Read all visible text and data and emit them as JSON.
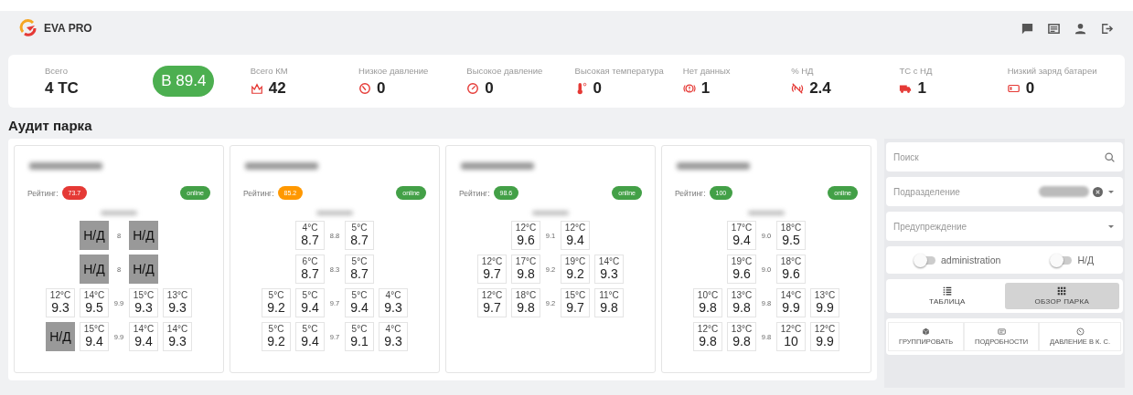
{
  "app": {
    "name": "EVA PRO"
  },
  "stats": [
    {
      "kind": "total",
      "label": "Всего",
      "value": "4 ТС"
    },
    {
      "kind": "rating",
      "value": "B 89.4"
    },
    {
      "kind": "distance",
      "label": "Всего КМ",
      "value": "42"
    },
    {
      "kind": "low_pressure",
      "label": "Низкое давление",
      "value": "0"
    },
    {
      "kind": "high_pressure",
      "label": "Высокое давление",
      "value": "0"
    },
    {
      "kind": "temperature",
      "label": "Высокая температура",
      "value": "0"
    },
    {
      "kind": "no_data",
      "label": "Нет данных",
      "value": "1"
    },
    {
      "kind": "no_signal",
      "label": "% НД",
      "value": "2.4"
    },
    {
      "kind": "vehicles_no_data",
      "label": "ТС с НД",
      "value": "1"
    },
    {
      "kind": "battery",
      "label": "Низкий заряд батареи",
      "value": "0"
    }
  ],
  "page_title": "Аудит парка",
  "vehicles": [
    {
      "rating_label": "Рейтинг:",
      "rating": "73.7",
      "color": "#e53935",
      "status": "online",
      "axles": [
        {
          "left": [
            {
              "kind": "nodata",
              "label": "Н/Д"
            }
          ],
          "center": "8",
          "right": [
            {
              "kind": "nodata",
              "label": "Н/Д"
            }
          ]
        },
        {
          "left": [
            {
              "kind": "nodata",
              "label": "Н/Д"
            }
          ],
          "center": "8",
          "right": [
            {
              "kind": "nodata",
              "label": "Н/Д"
            }
          ]
        },
        {
          "left": [
            {
              "kind": "reading",
              "temp": "12°C",
              "pressure": "9.3"
            },
            {
              "kind": "reading",
              "temp": "14°C",
              "pressure": "9.5"
            }
          ],
          "center": "9.9",
          "right": [
            {
              "kind": "reading",
              "temp": "15°C",
              "pressure": "9.3"
            },
            {
              "kind": "reading",
              "temp": "13°C",
              "pressure": "9.3"
            }
          ]
        },
        {
          "left": [
            {
              "kind": "nodata",
              "label": "Н/Д"
            },
            {
              "kind": "reading",
              "temp": "15°C",
              "pressure": "9.4"
            }
          ],
          "center": "9.9",
          "right": [
            {
              "kind": "reading",
              "temp": "14°C",
              "pressure": "9.4"
            },
            {
              "kind": "reading",
              "temp": "14°C",
              "pressure": "9.3"
            }
          ]
        }
      ]
    },
    {
      "rating_label": "Рейтинг:",
      "rating": "85.2",
      "color": "#ff9800",
      "status": "online",
      "axles": [
        {
          "left": [
            {
              "kind": "reading",
              "temp": "4°C",
              "pressure": "8.7"
            }
          ],
          "center": "8.8",
          "right": [
            {
              "kind": "reading",
              "temp": "5°C",
              "pressure": "8.7"
            }
          ]
        },
        {
          "left": [
            {
              "kind": "reading",
              "temp": "6°C",
              "pressure": "8.7"
            }
          ],
          "center": "8.3",
          "right": [
            {
              "kind": "reading",
              "temp": "5°C",
              "pressure": "8.7"
            }
          ]
        },
        {
          "left": [
            {
              "kind": "reading",
              "temp": "5°C",
              "pressure": "9.2"
            },
            {
              "kind": "reading",
              "temp": "5°C",
              "pressure": "9.4"
            }
          ],
          "center": "9.7",
          "right": [
            {
              "kind": "reading",
              "temp": "5°C",
              "pressure": "9.4"
            },
            {
              "kind": "reading",
              "temp": "4°C",
              "pressure": "9.3"
            }
          ]
        },
        {
          "left": [
            {
              "kind": "reading",
              "temp": "5°C",
              "pressure": "9.2"
            },
            {
              "kind": "reading",
              "temp": "5°C",
              "pressure": "9.4"
            }
          ],
          "center": "9.7",
          "right": [
            {
              "kind": "reading",
              "temp": "5°C",
              "pressure": "9.1"
            },
            {
              "kind": "reading",
              "temp": "4°C",
              "pressure": "9.3"
            }
          ]
        }
      ]
    },
    {
      "rating_label": "Рейтинг:",
      "rating": "98.6",
      "color": "#43a047",
      "status": "online",
      "axles": [
        {
          "left": [
            {
              "kind": "reading",
              "temp": "12°C",
              "pressure": "9.6"
            }
          ],
          "center": "9.1",
          "right": [
            {
              "kind": "reading",
              "temp": "12°C",
              "pressure": "9.4"
            }
          ]
        },
        {
          "left": [
            {
              "kind": "reading",
              "temp": "12°C",
              "pressure": "9.7"
            },
            {
              "kind": "reading",
              "temp": "17°C",
              "pressure": "9.8"
            }
          ],
          "center": "9.2",
          "right": [
            {
              "kind": "reading",
              "temp": "19°C",
              "pressure": "9.2"
            },
            {
              "kind": "reading",
              "temp": "14°C",
              "pressure": "9.3"
            }
          ]
        },
        {
          "left": [
            {
              "kind": "reading",
              "temp": "12°C",
              "pressure": "9.7"
            },
            {
              "kind": "reading",
              "temp": "18°C",
              "pressure": "9.8"
            }
          ],
          "center": "9.2",
          "right": [
            {
              "kind": "reading",
              "temp": "15°C",
              "pressure": "9.7"
            },
            {
              "kind": "reading",
              "temp": "11°C",
              "pressure": "9.8"
            }
          ]
        }
      ]
    },
    {
      "rating_label": "Рейтинг:",
      "rating": "100",
      "color": "#43a047",
      "status": "online",
      "axles": [
        {
          "left": [
            {
              "kind": "reading",
              "temp": "17°C",
              "pressure": "9.4"
            }
          ],
          "center": "9.0",
          "right": [
            {
              "kind": "reading",
              "temp": "18°C",
              "pressure": "9.5"
            }
          ]
        },
        {
          "left": [
            {
              "kind": "reading",
              "temp": "19°C",
              "pressure": "9.6"
            }
          ],
          "center": "9.0",
          "right": [
            {
              "kind": "reading",
              "temp": "18°C",
              "pressure": "9.6"
            }
          ]
        },
        {
          "left": [
            {
              "kind": "reading",
              "temp": "10°C",
              "pressure": "9.8"
            },
            {
              "kind": "reading",
              "temp": "13°C",
              "pressure": "9.8"
            }
          ],
          "center": "9.8",
          "right": [
            {
              "kind": "reading",
              "temp": "14°C",
              "pressure": "9.9"
            },
            {
              "kind": "reading",
              "temp": "13°C",
              "pressure": "9.9"
            }
          ]
        },
        {
          "left": [
            {
              "kind": "reading",
              "temp": "12°C",
              "pressure": "9.8"
            },
            {
              "kind": "reading",
              "temp": "13°C",
              "pressure": "9.8"
            }
          ],
          "center": "9.8",
          "right": [
            {
              "kind": "reading",
              "temp": "12°C",
              "pressure": "10"
            },
            {
              "kind": "reading",
              "temp": "12°C",
              "pressure": "9.9"
            }
          ]
        }
      ]
    }
  ],
  "sidebar": {
    "search": {
      "placeholder": "Поиск"
    },
    "subdivision": {
      "placeholder": "Подразделение"
    },
    "warning": {
      "placeholder": "Предупреждение"
    },
    "toggles": [
      {
        "label": "administration",
        "on": false
      },
      {
        "label": "Н/Д",
        "on": false
      }
    ],
    "views": [
      {
        "kind": "table",
        "label": "ТАБЛИЦА",
        "selected": false
      },
      {
        "kind": "overview",
        "label": "ОБЗОР ПАРКА",
        "selected": true
      }
    ],
    "actions": [
      {
        "kind": "group",
        "label": "ГРУППИРОВАТЬ"
      },
      {
        "kind": "details",
        "label": "ПОДРОБНОСТИ"
      },
      {
        "kind": "pressure",
        "label": "ДАВЛЕНИЕ В К. С."
      }
    ]
  }
}
